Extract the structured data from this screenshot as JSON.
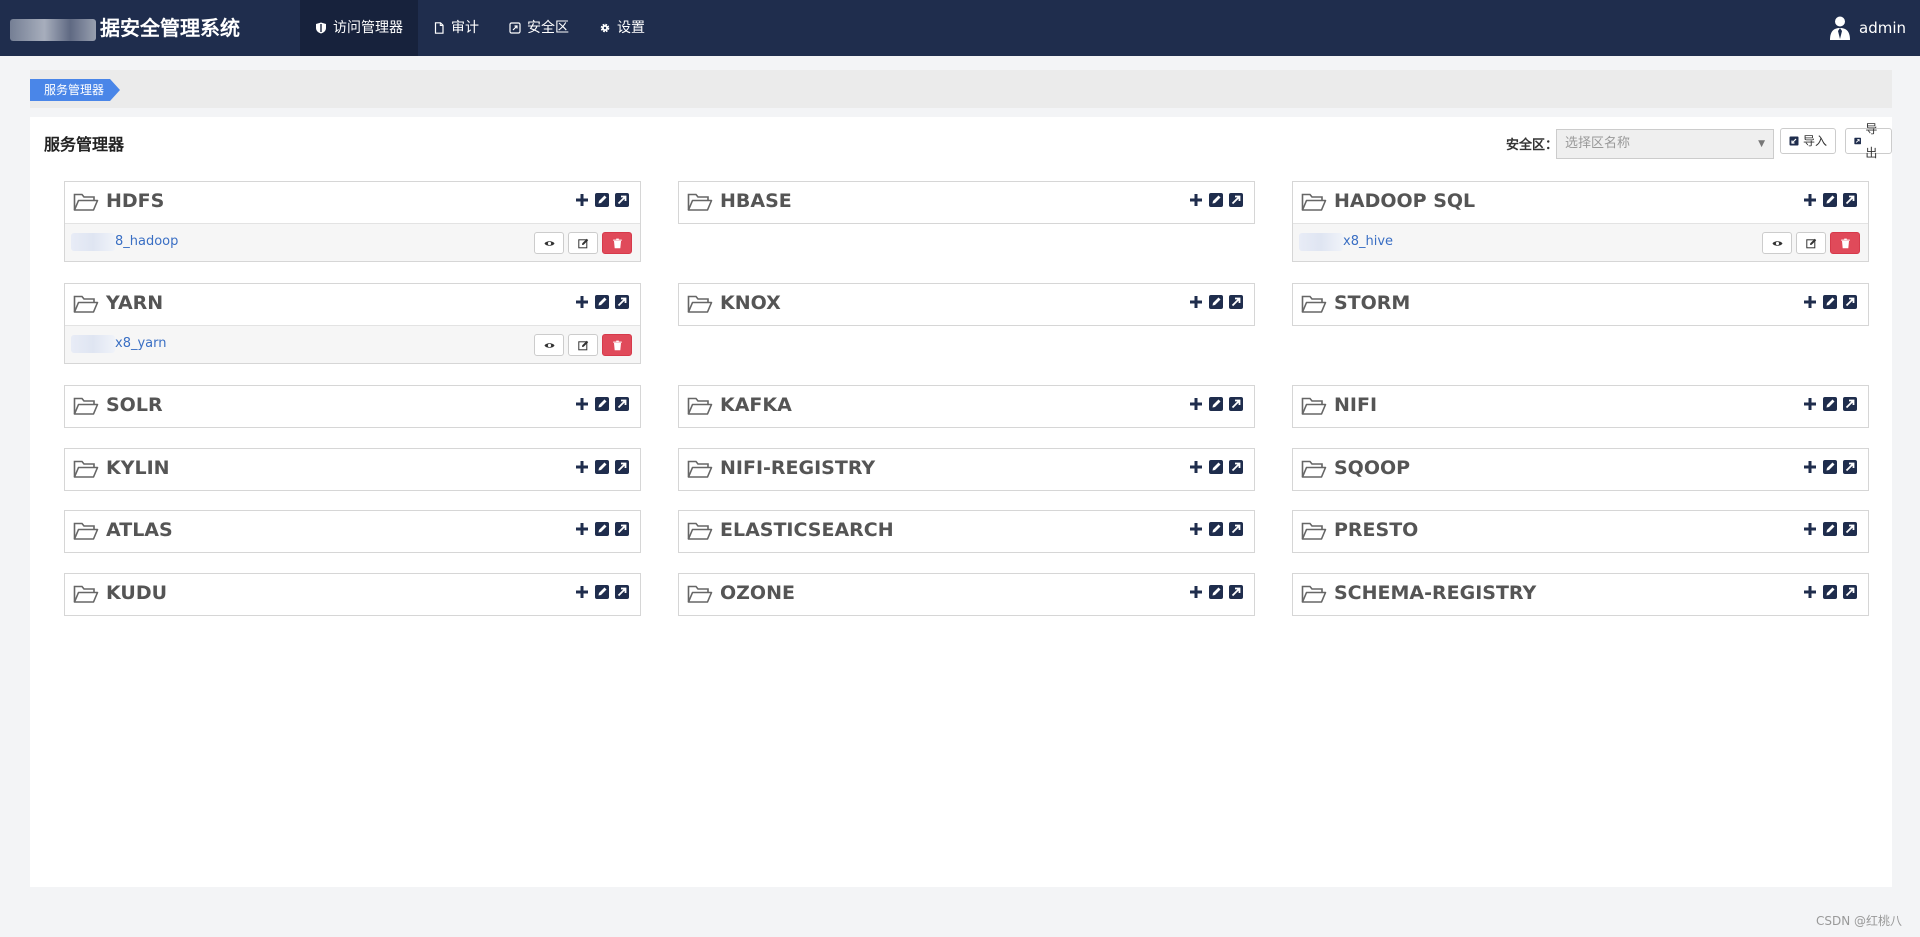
{
  "app": {
    "title": "据安全管理系统"
  },
  "nav": {
    "items": [
      {
        "label": "访问管理器",
        "icon": "shield-icon",
        "active": true
      },
      {
        "label": "审计",
        "icon": "file-icon",
        "active": false
      },
      {
        "label": "安全区",
        "icon": "zone-icon",
        "active": false
      },
      {
        "label": "设置",
        "icon": "gear-icon",
        "active": false
      }
    ]
  },
  "user": {
    "name": "admin",
    "icon": "user-icon"
  },
  "breadcrumb": {
    "current": "服务管理器"
  },
  "page": {
    "title": "服务管理器",
    "zone_label": "安全区：",
    "zone_placeholder": "选择区名称",
    "import_label": "导入",
    "export_label": "导出"
  },
  "services": [
    {
      "name": "HDFS",
      "entries": [
        {
          "name": "8_hadoop"
        }
      ]
    },
    {
      "name": "HBASE",
      "entries": []
    },
    {
      "name": "HADOOP SQL",
      "entries": [
        {
          "name": "x8_hive"
        }
      ]
    },
    {
      "name": "YARN",
      "entries": [
        {
          "name": "x8_yarn"
        }
      ]
    },
    {
      "name": "KNOX",
      "entries": []
    },
    {
      "name": "STORM",
      "entries": []
    },
    {
      "name": "SOLR",
      "entries": []
    },
    {
      "name": "KAFKA",
      "entries": []
    },
    {
      "name": "NIFI",
      "entries": []
    },
    {
      "name": "KYLIN",
      "entries": []
    },
    {
      "name": "NIFI-REGISTRY",
      "entries": []
    },
    {
      "name": "SQOOP",
      "entries": []
    },
    {
      "name": "ATLAS",
      "entries": []
    },
    {
      "name": "ELASTICSEARCH",
      "entries": []
    },
    {
      "name": "PRESTO",
      "entries": []
    },
    {
      "name": "KUDU",
      "entries": []
    },
    {
      "name": "OZONE",
      "entries": []
    },
    {
      "name": "SCHEMA-REGISTRY",
      "entries": []
    }
  ],
  "footer": {
    "watermark": "CSDN @红桃八"
  },
  "colors": {
    "navbar": "#1f2d4d",
    "accent": "#4a86e8",
    "danger": "#e04a5a"
  }
}
